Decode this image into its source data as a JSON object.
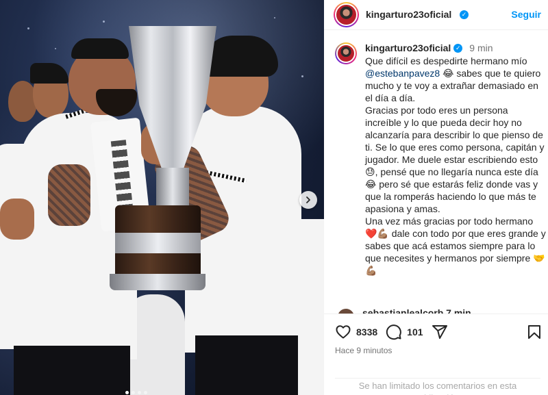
{
  "header": {
    "username": "kingarturo23oficial",
    "follow_label": "Seguir"
  },
  "caption": {
    "username": "kingarturo23oficial",
    "time": "9 min",
    "paragraph1_pre": "Que difícil es despedirte hermano mío ",
    "mention": "@estebanpavez8",
    "paragraph1_post": " 😂 sabes que te quiero mucho y te voy a extrañar demasiado en el día a día.",
    "paragraph2": "Gracias por todo eres un persona increíble y lo que pueda decir hoy no alcanzaría para describir lo que pienso de ti. Se lo que eres como persona, capitán y jugador. Me duele estar escribiendo esto 😓, pensé que no llegaría nunca este día 😂 pero sé que estarás feliz donde vas y que la romperás haciendo lo que más te apasiona y amas.",
    "paragraph3": "Una vez más gracias por todo hermano ❤️💪🏽 dale con todo por que eres grande y sabes que acá estamos siempre para lo que necesites y hermanos por siempre 🤝💪🏽"
  },
  "next_comment": {
    "username": "sebastianlealcorb 7 min"
  },
  "actions": {
    "likes": "8338",
    "comments": "101",
    "posted": "Hace 9 minutos"
  },
  "footer": {
    "limited_notice": "Se han limitado los comentarios en esta publicación."
  },
  "icons": {
    "like": "heart-icon",
    "comment": "comment-icon",
    "share": "share-icon",
    "save": "bookmark-icon",
    "next": "chevron-right-icon",
    "verified": "verified-badge-icon"
  },
  "colors": {
    "accent": "#0095f6",
    "mention": "#00376b",
    "muted": "#737373"
  },
  "carousel": {
    "total": 4,
    "active": 1
  }
}
